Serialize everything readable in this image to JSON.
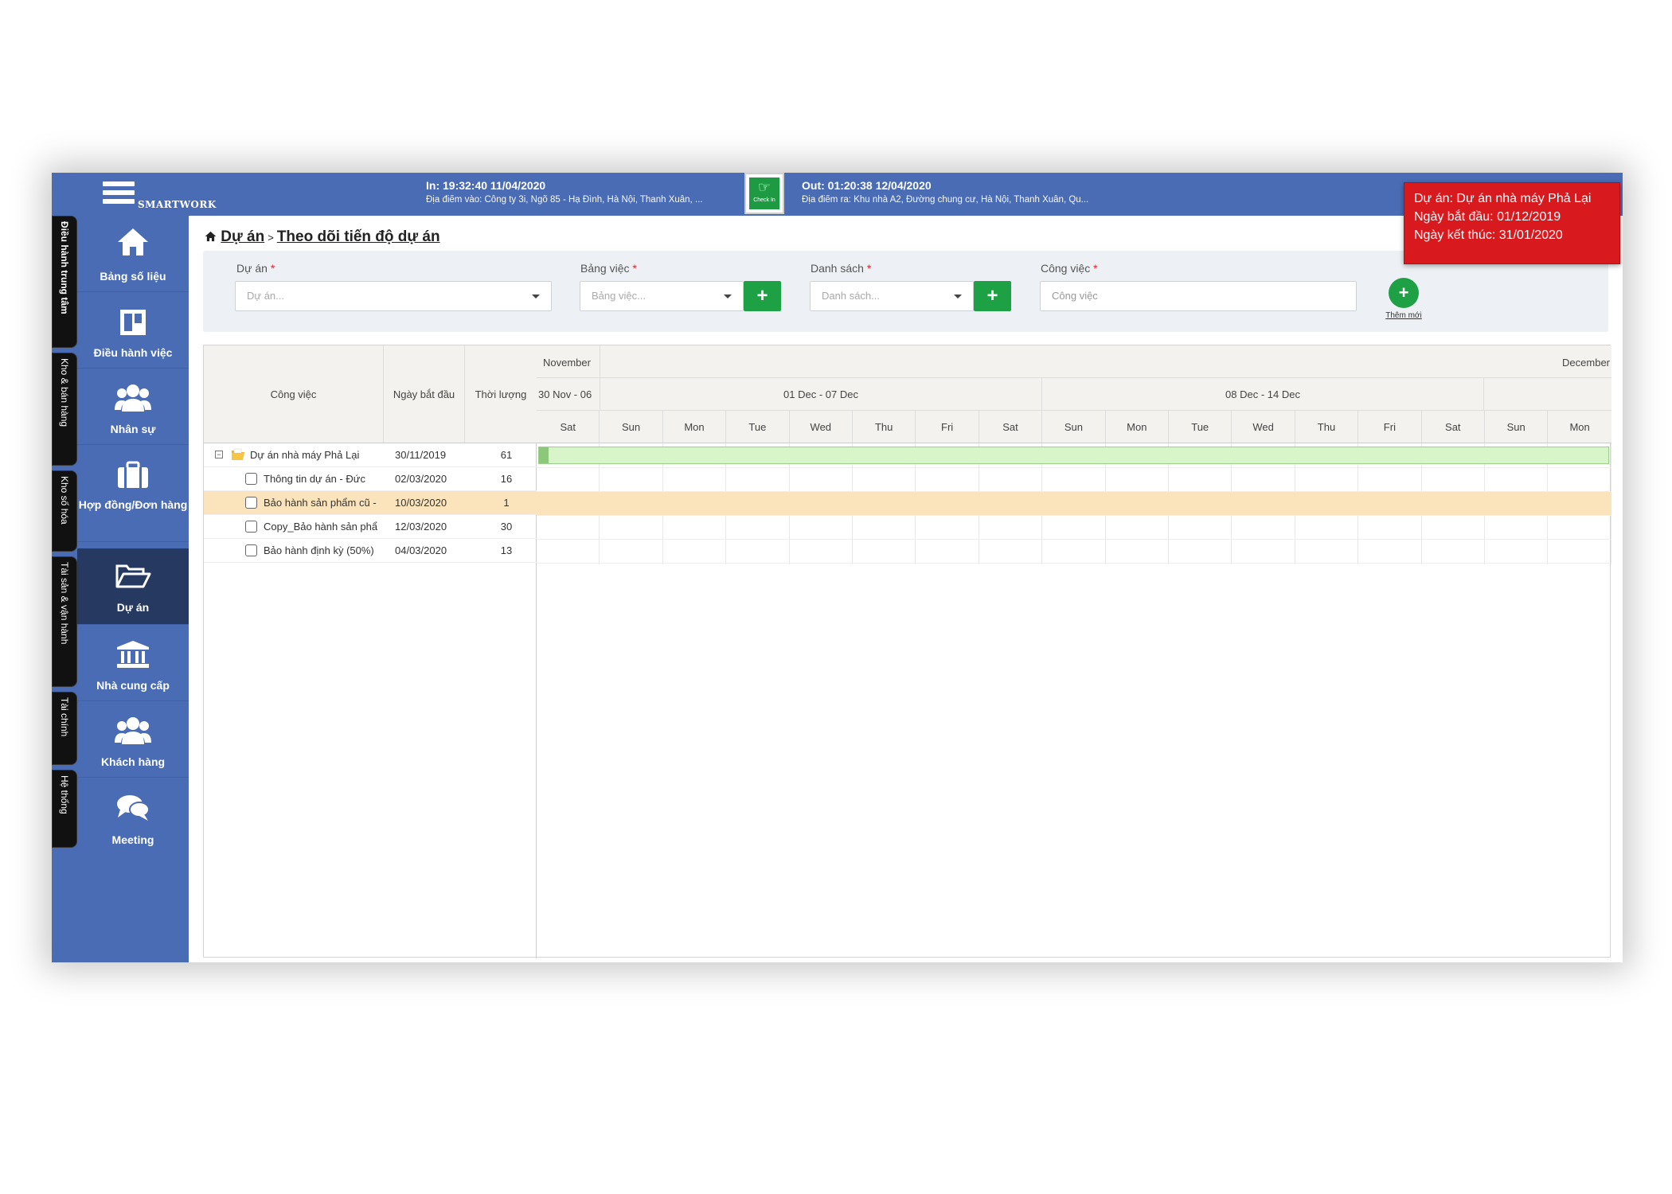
{
  "header": {
    "brand": "SMARTWORK",
    "check_in": {
      "line1": "In: 19:32:40 11/04/2020",
      "line2": "Địa điểm vào: Công ty 3i, Ngõ 85 - Hạ Đình, Hà Nội, Thanh Xuân, ..."
    },
    "check_out": {
      "line1": "Out: 01:20:38 12/04/2020",
      "line2": "Địa điểm ra: Khu nhà A2, Đường chung cư, Hà Nội, Thanh Xuân, Qu..."
    },
    "checkin_button_label": "Check In"
  },
  "vertical_tabs": [
    {
      "label": "Điều hành trung tâm",
      "icon": "gear-icon"
    },
    {
      "label": "Kho & bán hàng",
      "icon": "cube-icon"
    },
    {
      "label": "Kho số hóa",
      "icon": "book-icon"
    },
    {
      "label": "Tài sản & vận hành",
      "icon": "gears-icon"
    },
    {
      "label": "Tài chính",
      "icon": "chart-icon"
    },
    {
      "label": "Hệ thống",
      "icon": "check-icon"
    }
  ],
  "sidebar": {
    "items": [
      {
        "label": "Bảng số liệu",
        "icon": "home-icon"
      },
      {
        "label": "Điều hành việc",
        "icon": "board-icon"
      },
      {
        "label": "Nhân sự",
        "icon": "users-icon"
      },
      {
        "label": "Hợp đồng/Đơn hàng",
        "icon": "briefcase-icon"
      },
      {
        "label": "Dự án",
        "icon": "folder-open-icon",
        "active": true
      },
      {
        "label": "Nhà cung cấp",
        "icon": "bank-icon"
      },
      {
        "label": "Khách hàng",
        "icon": "users-icon"
      },
      {
        "label": "Meeting",
        "icon": "chat-icon"
      }
    ]
  },
  "breadcrumb": {
    "root": "Dự án",
    "separator": ">",
    "current": "Theo dõi tiến độ dự án"
  },
  "filters": {
    "project": {
      "label": "Dự án",
      "placeholder": "Dự án..."
    },
    "board": {
      "label": "Bảng việc",
      "placeholder": "Bảng việc..."
    },
    "list": {
      "label": "Danh sách",
      "placeholder": "Danh sách..."
    },
    "task": {
      "label": "Công việc",
      "placeholder": "Công việc"
    },
    "required_mark": "*",
    "add_new_label": "Thêm mới"
  },
  "gantt": {
    "columns": [
      "Công việc",
      "Ngày bắt đầu",
      "Thời lượng"
    ],
    "rows": [
      {
        "name": "Dự án nhà máy Phả Lại",
        "start": "30/11/2019",
        "duration": "61",
        "type": "project"
      },
      {
        "name": "Thông tin dự án - Đức",
        "start": "02/03/2020",
        "duration": "16",
        "type": "task"
      },
      {
        "name": "Bảo hành sản phẩm cũ - ",
        "start": "10/03/2020",
        "duration": "1",
        "type": "task",
        "highlight": true
      },
      {
        "name": "Copy_Bảo hành sản phẩ",
        "start": "12/03/2020",
        "duration": "30",
        "type": "task"
      },
      {
        "name": "Bảo hành định kỳ (50%)",
        "start": "04/03/2020",
        "duration": "13",
        "type": "task"
      }
    ],
    "months": [
      "November",
      "December"
    ],
    "weeks": [
      "30 Nov - 06",
      "01 Dec - 07 Dec",
      "08 Dec - 14 Dec"
    ],
    "days": [
      "Sat",
      "Sun",
      "Mon",
      "Tue",
      "Wed",
      "Thu",
      "Fri",
      "Sat",
      "Sun",
      "Mon",
      "Tue",
      "Wed",
      "Thu",
      "Fri",
      "Sat",
      "Sun",
      "Mon"
    ]
  },
  "tooltip": {
    "project": "Dự án: Dự án nhà máy Phả Lại",
    "start": "Ngày bắt đầu: 01/12/2019",
    "end": "Ngày kết thúc: 31/01/2020"
  },
  "colors": {
    "header_blue": "#4a6cb5",
    "active_nav": "#263a61",
    "green": "#1ea145",
    "tooltip_red": "#d8191e",
    "highlight_row": "#fbe4bc"
  }
}
